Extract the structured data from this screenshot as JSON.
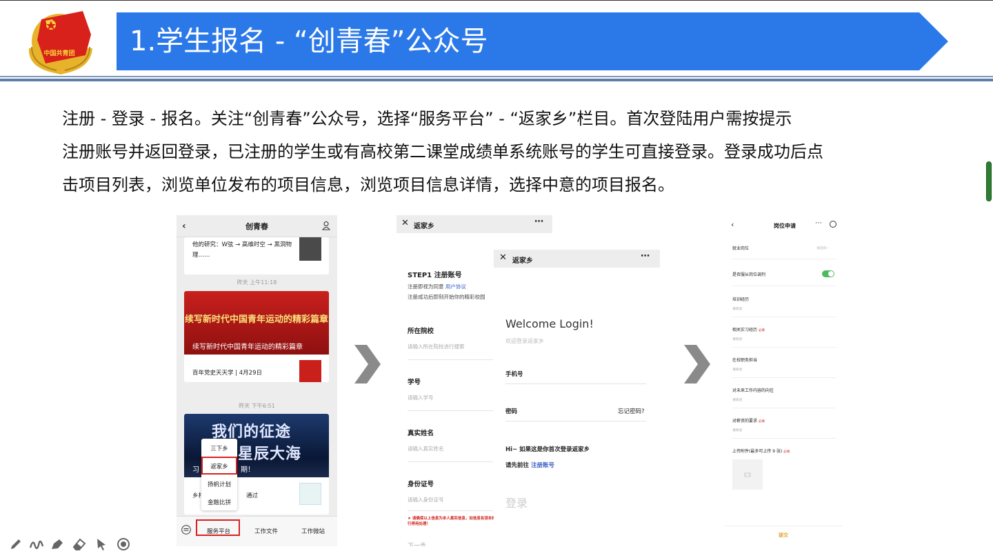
{
  "header": {
    "title": "1.学生报名 - “创青春”公众号",
    "emblem_text": "中国共青团",
    "banner_color": "#2b79e9"
  },
  "description": {
    "line1": "注册 - 登录 - 报名。关注“创青春”公众号，选择“服务平台” - “返家乡”栏目。首次登陆用户需按提示",
    "line2": "注册账号并返回登录，已注册的学生或有高校第二课堂成绩单系统账号的学生可直接登录。登录成功后点",
    "line3": "击项目列表，浏览单位发布的项目信息，浏览项目信息详情，选择中意的项目报名。"
  },
  "phone1": {
    "nav_title": "创青春",
    "card1_text": "他的研究：W弦 → 高维时空 → 黑洞物理……",
    "time1": "昨天 上午11:18",
    "card2_banner_title": "续写新时代中国青年运动的精彩篇章",
    "card2_caption": "续写新时代中国青年运动的精彩篇章",
    "card2_sub": "百年党史天天学 | 4月29日",
    "time2": "昨天 下午6:51",
    "card3_banner_line1": "我们的征途",
    "card3_banner_line2": "星辰大海",
    "card3_cap_a": "习",
    "card3_cap_b": "期！",
    "card3_sub_a": "乡村",
    "card3_sub_b": "通过",
    "menu": [
      "三下乡",
      "返家乡",
      "扬帆计划",
      "金融比拼"
    ],
    "tabs": [
      "服务平台",
      "工作文件",
      "工作微站"
    ]
  },
  "phone2": {
    "nav_title": "返家乡",
    "step": "STEP1 注册账号",
    "agree_prefix": "注册即视为同意 ",
    "agree_link": "用户协议",
    "agree_line2": "注册成功后即刻开始你的精彩校园",
    "fields": [
      {
        "label": "所在院校",
        "placeholder": "请输入所在院校进行搜索"
      },
      {
        "label": "学号",
        "placeholder": "请输入学号"
      },
      {
        "label": "真实姓名",
        "placeholder": "请输入真实姓名"
      },
      {
        "label": "身份证号",
        "placeholder": "请输入身份证号"
      }
    ],
    "warning": "★ 请确保以上信息为本人真实信息，如信息有误本校第二课堂系统有权对该账号进行停用处理！",
    "next": "下一步"
  },
  "phone3": {
    "nav_title": "返家乡",
    "welcome": "Welcome Login!",
    "welcome_sub": "欢迎登录返家乡",
    "phone_label": "手机号",
    "password_label": "密码",
    "forgot": "忘记密码?",
    "hint1": "Hi~ 如果这是你首次登录返家乡",
    "hint2_prefix": "请先前往 ",
    "hint2_link": "注册账号",
    "login": "登录"
  },
  "phone4": {
    "nav_title": "岗位申请",
    "rows": [
      {
        "label": "就业岗位",
        "placeholder": ""
      },
      {
        "label": "是否服从岗位调剂",
        "placeholder": ""
      },
      {
        "label": "培训经历",
        "placeholder": "请简述"
      },
      {
        "label": "相关实习经历",
        "placeholder": "请简述",
        "required": "必填"
      },
      {
        "label": "在校职务担当",
        "placeholder": "请简述"
      },
      {
        "label": "对未来工作内容的向往",
        "placeholder": "请简述"
      },
      {
        "label": "对薪资的要求",
        "placeholder": "请简述",
        "required": "必填"
      },
      {
        "label": "上传附件(最多可上传 9 张)",
        "placeholder": "",
        "required": "必填"
      }
    ],
    "select_ph": "请选择",
    "toggle_on": true,
    "submit": "提交"
  }
}
